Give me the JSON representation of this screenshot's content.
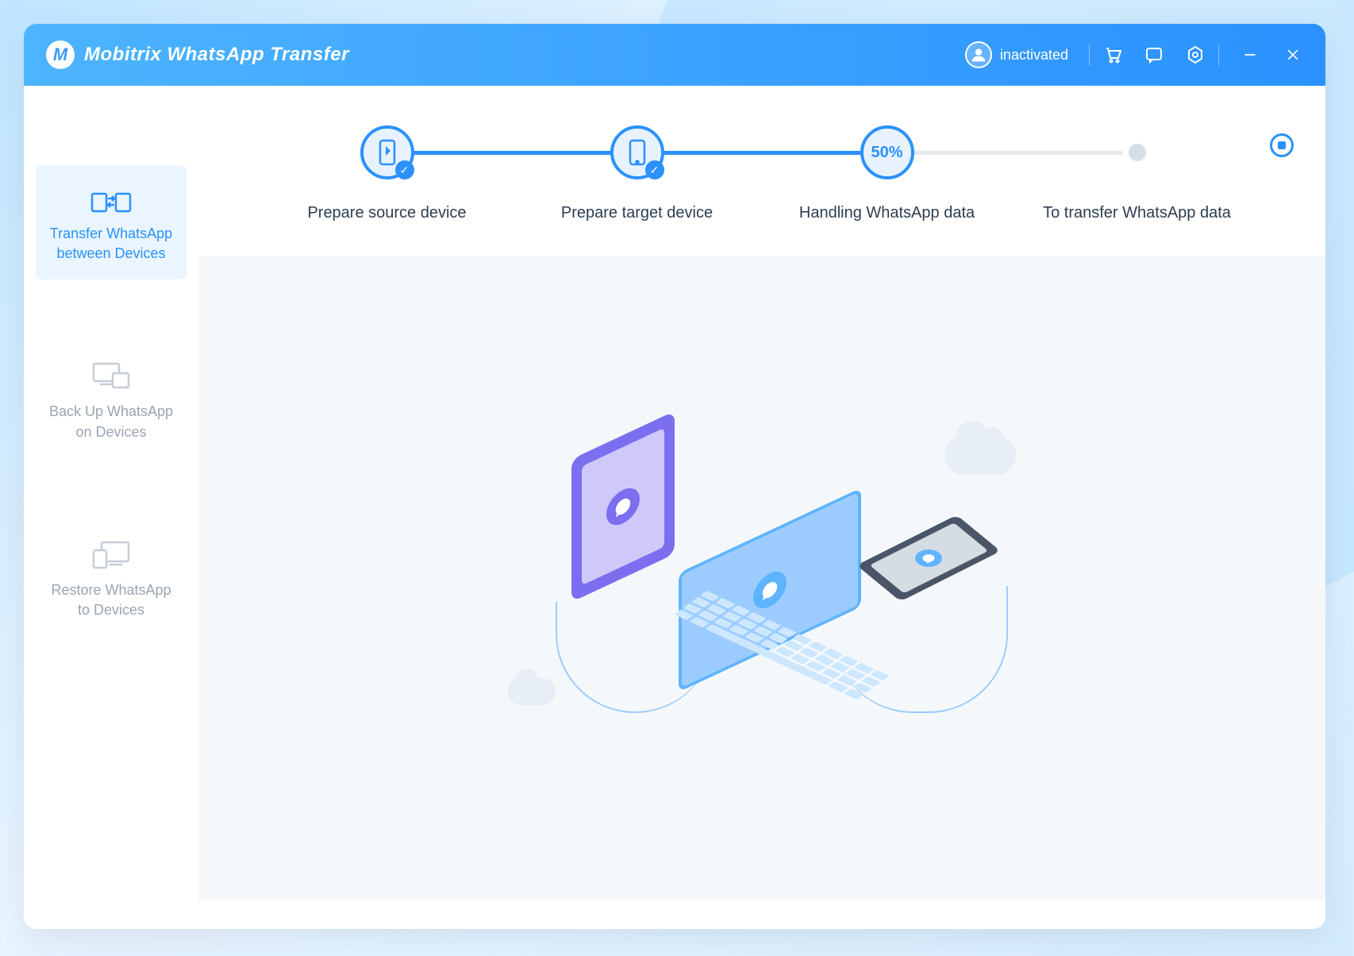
{
  "app": {
    "title": "Mobitrix WhatsApp Transfer"
  },
  "user": {
    "status": "inactivated"
  },
  "sidebar": {
    "items": [
      {
        "label": "Transfer WhatsApp between Devices",
        "active": true
      },
      {
        "label": "Back Up WhatsApp on Devices",
        "active": false
      },
      {
        "label": "Restore WhatsApp to Devices",
        "active": false
      }
    ]
  },
  "progress": {
    "steps": [
      {
        "label": "Prepare source device",
        "state": "done"
      },
      {
        "label": "Prepare target device",
        "state": "done"
      },
      {
        "label": "Handling WhatsApp data",
        "state": "active",
        "percent": "50%"
      },
      {
        "label": "To transfer WhatsApp data",
        "state": "pending"
      }
    ]
  }
}
